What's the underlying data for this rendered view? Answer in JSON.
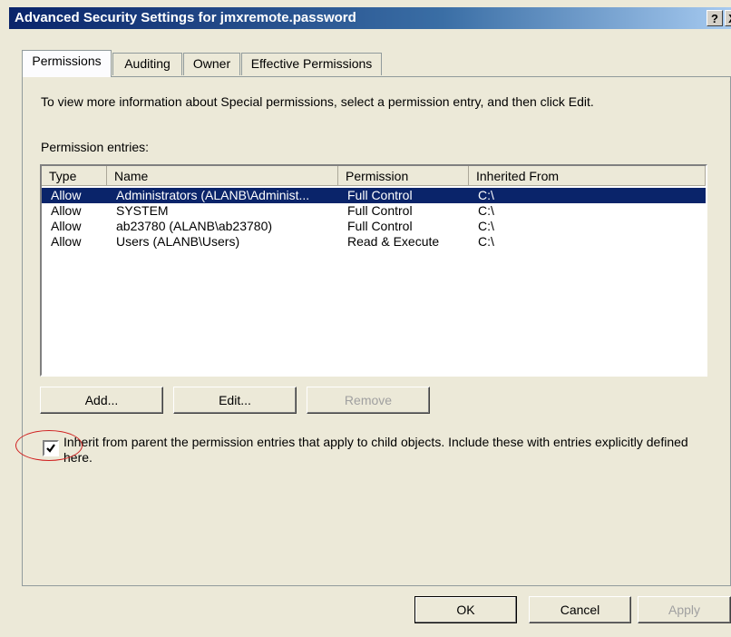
{
  "window": {
    "title": "Advanced Security Settings for jmxremote.password",
    "help_glyph": "?",
    "close_glyph": "X"
  },
  "tabs": [
    {
      "label": "Permissions",
      "active": true
    },
    {
      "label": "Auditing",
      "active": false
    },
    {
      "label": "Owner",
      "active": false
    },
    {
      "label": "Effective Permissions",
      "active": false
    }
  ],
  "info_text": "To view more information about Special permissions, select a permission entry, and then click Edit.",
  "entries_label": "Permission entries:",
  "columns": {
    "type": "Type",
    "name": "Name",
    "permission": "Permission",
    "inherited": "Inherited From"
  },
  "rows": [
    {
      "type": "Allow",
      "name": "Administrators (ALANB\\Administ...",
      "permission": "Full Control",
      "inherited": "C:\\",
      "selected": true
    },
    {
      "type": "Allow",
      "name": "SYSTEM",
      "permission": "Full Control",
      "inherited": "C:\\",
      "selected": false
    },
    {
      "type": "Allow",
      "name": "ab23780 (ALANB\\ab23780)",
      "permission": "Full Control",
      "inherited": "C:\\",
      "selected": false
    },
    {
      "type": "Allow",
      "name": "Users (ALANB\\Users)",
      "permission": "Read & Execute",
      "inherited": "C:\\",
      "selected": false
    }
  ],
  "buttons": {
    "add": "Add...",
    "edit": "Edit...",
    "remove": "Remove",
    "ok": "OK",
    "cancel": "Cancel",
    "apply": "Apply"
  },
  "inherit_checkbox": {
    "checked": true,
    "label": "Inherit from parent the permission entries that apply to child objects. Include these with entries explicitly defined here."
  },
  "colors": {
    "selection": "#0a246a",
    "annotation": "#d02020"
  }
}
